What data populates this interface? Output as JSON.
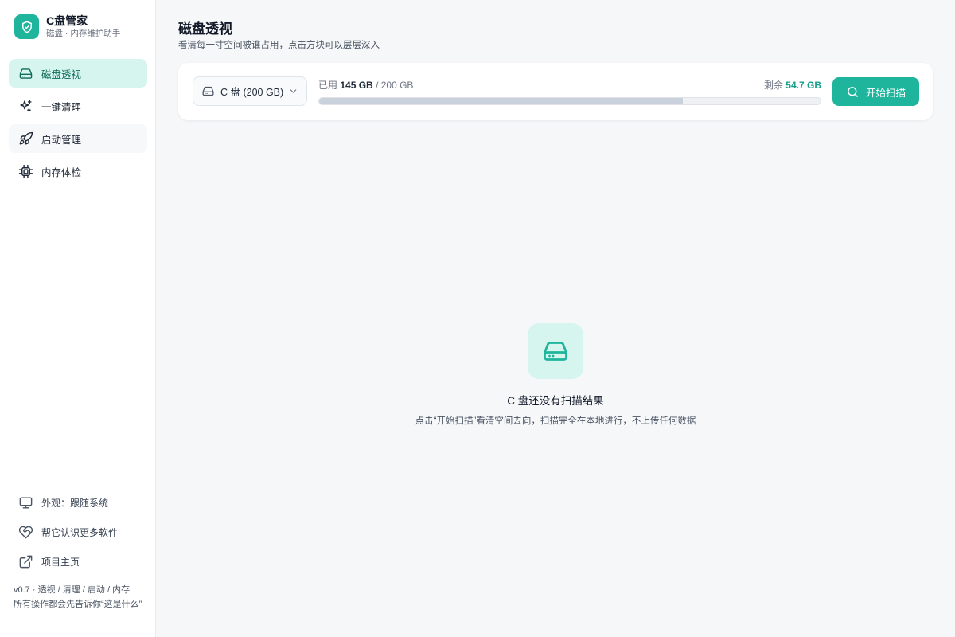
{
  "app": {
    "title": "C盘管家",
    "subtitle": "磁盘 · 内存维护助手"
  },
  "sidebar": {
    "items": [
      {
        "label": "磁盘透视",
        "icon": "hard-drive-icon",
        "active": true
      },
      {
        "label": "一键清理",
        "icon": "sparkles-icon",
        "active": false
      },
      {
        "label": "启动管理",
        "icon": "rocket-icon",
        "active": false
      },
      {
        "label": "内存体检",
        "icon": "cpu-chip-icon",
        "active": false
      }
    ],
    "footer": [
      {
        "label": "外观：跟随系统",
        "icon": "monitor-icon"
      },
      {
        "label": "帮它认识更多软件",
        "icon": "heart-handshake-icon"
      },
      {
        "label": "项目主页",
        "icon": "external-link-icon"
      }
    ],
    "version_line1": "v0.7 · 透视 / 清理 / 启动 / 内存",
    "version_line2": "所有操作都会先告诉你“这是什么”"
  },
  "main": {
    "title": "磁盘透视",
    "subtitle": "看清每一寸空间被谁占用，点击方块可以层层深入",
    "drive_select": {
      "value": "C 盘 (200 GB)",
      "icon": "hard-drive-icon"
    },
    "usage": {
      "used_label": "已用",
      "used_value": "145 GB",
      "total": "/ 200 GB",
      "free_label": "剩余",
      "free_value": "54.7 GB",
      "used_fraction": 0.725
    },
    "scan_button": {
      "label": "开始扫描",
      "icon": "search-icon"
    },
    "empty_state": {
      "icon": "hard-drive-icon",
      "title": "C 盘还没有扫描结果",
      "description": "点击“开始扫描”看清空间去向，扫描完全在本地进行，不上传任何数据"
    }
  },
  "colors": {
    "accent": "#1fb59c",
    "accent_light": "#d6f5ee",
    "free_text": "#16a08a"
  }
}
